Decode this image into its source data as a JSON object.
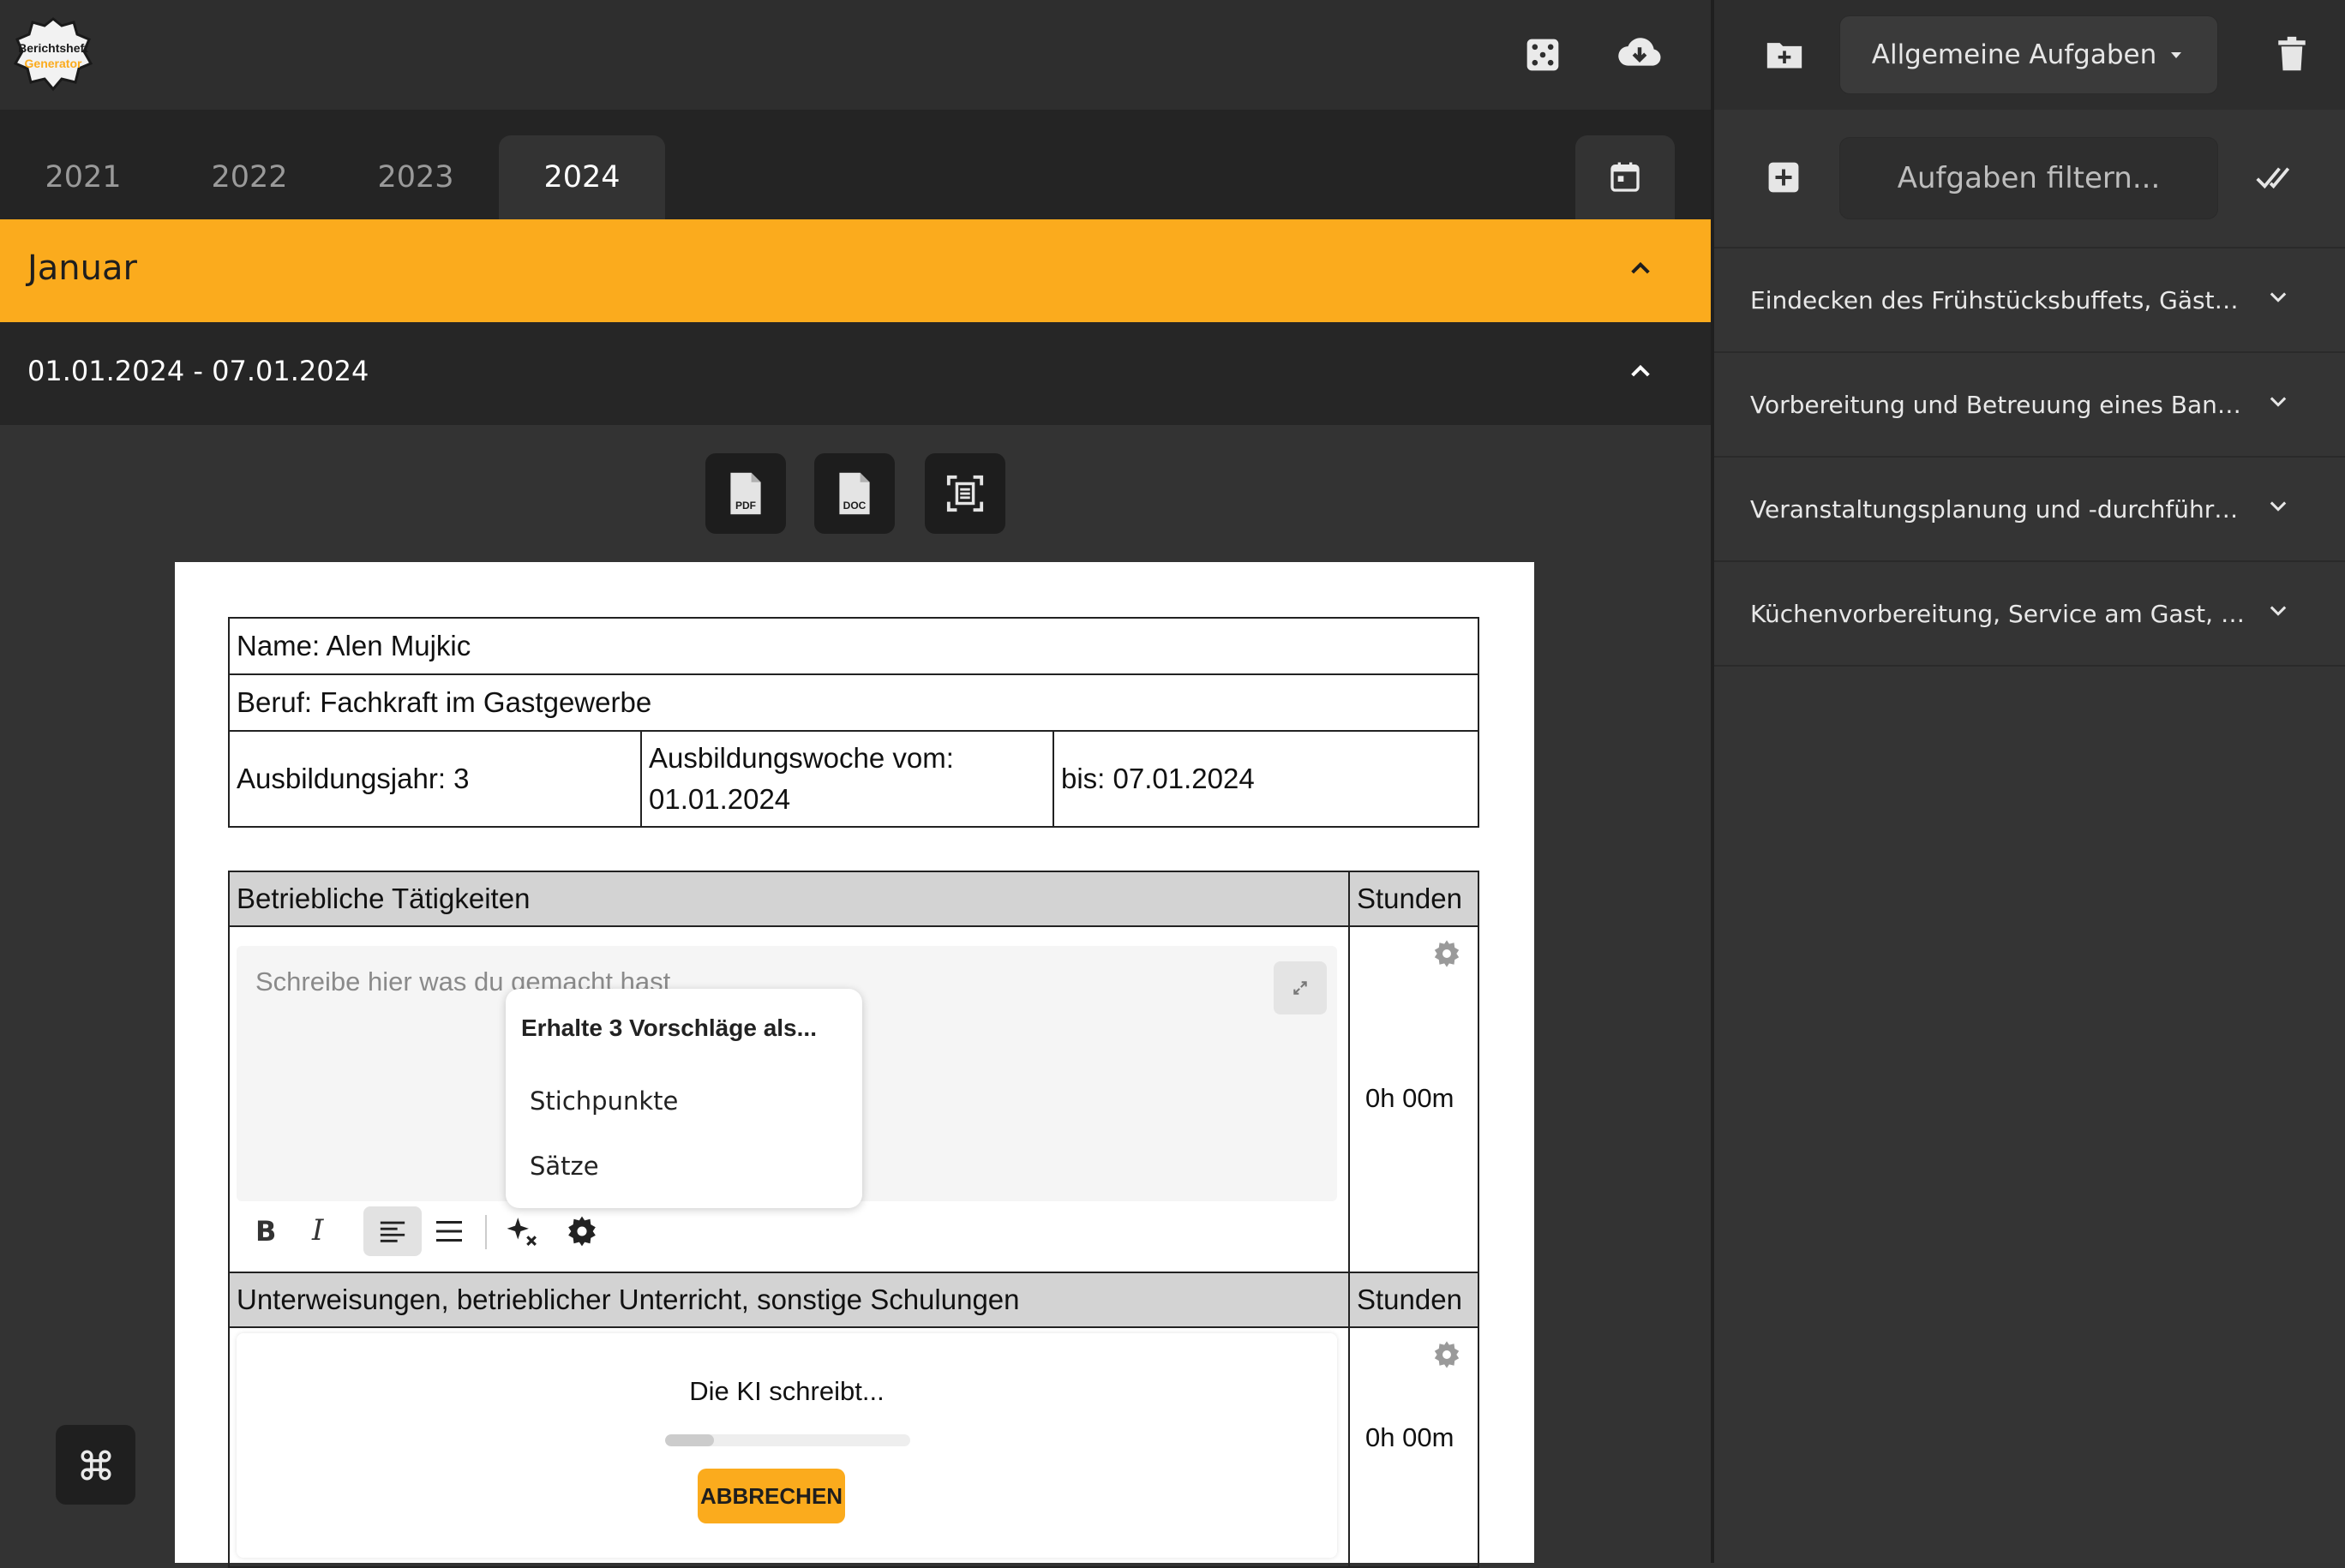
{
  "app": {
    "logo_text_1": "Berichtsheft",
    "logo_text_2": "Generator"
  },
  "years": {
    "tabs": [
      "2021",
      "2022",
      "2023",
      "2024"
    ],
    "active": "2024"
  },
  "month": {
    "label": "Januar"
  },
  "week": {
    "label": "01.01.2024 - 07.01.2024"
  },
  "export": {
    "pdf": "PDF",
    "doc": "DOC"
  },
  "report": {
    "name": "Name: Alen Mujkic",
    "beruf": "Beruf: Fachkraft im Gastgewerbe",
    "jahr": "Ausbildungsjahr: 3",
    "woche_label": "Ausbildungswoche vom:",
    "woche_date": "01.01.2024",
    "bis": "bis: 07.01.2024",
    "section1_title": "Betriebliche Tätigkeiten",
    "stunden_label": "Stunden",
    "section1_placeholder": "Schreibe hier was du gemacht hast",
    "section1_hours": "0h 00m",
    "section2_title": "Unterweisungen, betrieblicher Unterricht, sonstige Schulungen",
    "section2_hours": "0h 00m",
    "ai_writing": "Die KI schreibt...",
    "ai_progress": 0.2,
    "cancel_label": "ABBRECHEN"
  },
  "suggestions": {
    "title": "Erhalte 3 Vorschläge als...",
    "options": [
      "Stichpunkte",
      "Sätze"
    ]
  },
  "toolbar": {
    "bold": "B",
    "italic": "I"
  },
  "right": {
    "category": "Allgemeine Aufgaben",
    "filter_placeholder": "Aufgaben filtern...",
    "items": [
      "Eindecken des Frühstücksbuffets, Gästebetreuung",
      "Vorbereitung und Betreuung eines Banketts",
      "Veranstaltungsplanung und -durchführung",
      "Küchenvorbereitung, Service am Gast, Reinigung"
    ]
  },
  "colors": {
    "accent": "#fbab1d",
    "dark": "#2e2e2e",
    "panel": "#343434"
  }
}
